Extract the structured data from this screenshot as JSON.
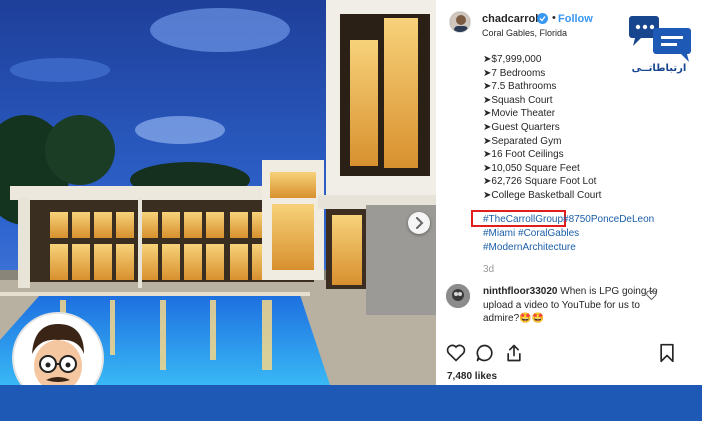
{
  "post": {
    "username": "chadcarroll",
    "follow_label": "Follow",
    "dot": "•",
    "location": "Coral Gables, Florida",
    "caption_lines": [
      "➤$7,999,000",
      "➤7 Bedrooms",
      "➤7.5 Bathrooms",
      "➤Squash Court",
      "➤Movie Theater",
      "➤Guest Quarters",
      "➤Separated Gym",
      "➤16 Foot Ceilings",
      "➤10,050 Square Feet",
      "➤62,726 Square Foot Lot",
      "➤College Basketball Court"
    ],
    "hashtags": {
      "highlighted": "#TheCarrollGroup",
      "second": "#8750PonceDeLeon",
      "line2a": "#Miami",
      "line2b": "#CoralGables",
      "line3": "#ModernArchitecture"
    },
    "age": "3d",
    "comment": {
      "user": "ninthfloor33020",
      "text": "When is LPG going to upload a video to YouTube for us to admire?🤩🤩"
    },
    "likes": "7,480 likes"
  },
  "logo": {
    "text": "ارتباطاتــی"
  },
  "colors": {
    "accent_blue": "#3897f0",
    "bottom_bar": "#1d59b5",
    "highlight_box": "#e21d1d",
    "hashtag": "#1b5ea8"
  },
  "icons": {
    "verified": "verified-badge-icon",
    "next": "chevron-right-icon",
    "like": "heart-icon",
    "comment": "comment-bubble-icon",
    "share": "share-icon",
    "save": "bookmark-icon"
  }
}
